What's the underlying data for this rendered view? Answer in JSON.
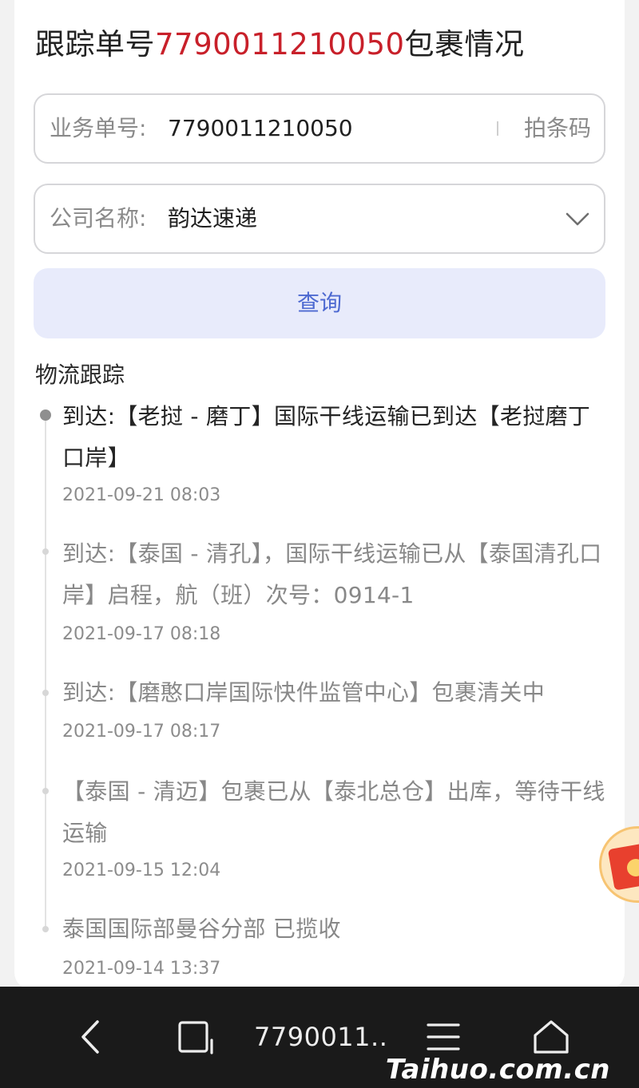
{
  "header": {
    "title_prefix": "跟踪单号",
    "tracking_number": "7790011210050",
    "title_suffix": "包裹情况"
  },
  "form": {
    "tracking_label": "业务单号:",
    "tracking_value": "7790011210050",
    "scan_label": "拍条码",
    "company_label": "公司名称:",
    "company_value": "韵达速递",
    "query_button": "查询"
  },
  "tracking": {
    "section_title": "物流跟踪",
    "events": [
      {
        "text": "到达:【老挝 - 磨丁】国际干线运输已到达【老挝磨丁口岸】",
        "time": "2021-09-21 08:03"
      },
      {
        "text": "到达:【泰国 - 清孔】，国际干线运输已从【泰国清孔口岸】启程，航（班）次号：0914-1",
        "time": "2021-09-17 08:18"
      },
      {
        "text": "到达:【磨憨口岸国际快件监管中心】包裹清关中",
        "time": "2021-09-17 08:17"
      },
      {
        "text": "【泰国 - 清迈】包裹已从【泰北总仓】出库，等待干线运输",
        "time": "2021-09-15 12:04"
      },
      {
        "text": "泰国国际部曼谷分部 已揽收",
        "time": "2021-09-14 13:37"
      }
    ]
  },
  "navbar": {
    "current_tab_title": "7790011..",
    "icons": [
      "back-icon",
      "tabs-icon",
      "menu-icon",
      "home-icon"
    ]
  },
  "watermark": "Taihuo.com.cn",
  "colors": {
    "accent_red": "#c8202a",
    "button_text_blue": "#4e6ad1",
    "button_bg": "#e8ebfb",
    "navbar_bg": "#1a1a1a"
  }
}
